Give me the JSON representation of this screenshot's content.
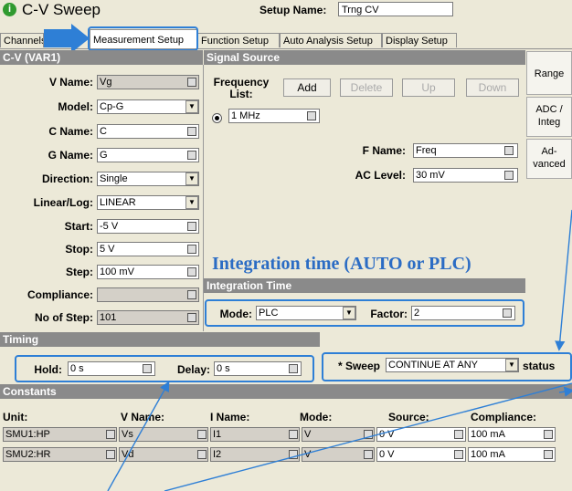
{
  "window": {
    "title": "C-V Sweep",
    "setup_label": "Setup Name:",
    "setup_name": "Trng CV"
  },
  "tabs": [
    {
      "label": "Channels"
    },
    {
      "label": "Measurement Setup"
    },
    {
      "label": "Function Setup"
    },
    {
      "label": "Auto Analysis Setup"
    },
    {
      "label": "Display Setup"
    }
  ],
  "cv": {
    "title": "C-V (VAR1)",
    "vname_label": "V Name:",
    "vname": "Vg",
    "model_label": "Model:",
    "model": "Cp-G",
    "cname_label": "C Name:",
    "cname": "C",
    "gname_label": "G Name:",
    "gname": "G",
    "direction_label": "Direction:",
    "direction": "Single",
    "linlog_label": "Linear/Log:",
    "linlog": "LINEAR",
    "start_label": "Start:",
    "start": "-5 V",
    "stop_label": "Stop:",
    "stop": "5 V",
    "step_label": "Step:",
    "step": "100 mV",
    "compliance_label": "Compliance:",
    "compliance": "",
    "nostep_label": "No of Step:",
    "nostep": "101"
  },
  "signal": {
    "title": "Signal Source",
    "freq_label": "Frequency List:",
    "add": "Add",
    "delete": "Delete",
    "up": "Up",
    "down": "Down",
    "freq_value": "1 MHz",
    "fname_label": "F Name:",
    "fname": "Freq",
    "aclevel_label": "AC Level:",
    "aclevel": "30 mV"
  },
  "side_buttons": {
    "range": "Range",
    "adc": "ADC / Integ",
    "advanced": "Ad-vanced"
  },
  "annotation": "Integration time (AUTO or PLC)",
  "integration": {
    "title": "Integration Time",
    "mode_label": "Mode:",
    "mode": "PLC",
    "factor_label": "Factor:",
    "factor": "2"
  },
  "timing": {
    "title": "Timing",
    "hold_label": "Hold:",
    "hold": "0 s",
    "delay_label": "Delay:",
    "delay": "0 s"
  },
  "sweep": {
    "label": "* Sweep",
    "value": "CONTINUE AT ANY",
    "status": "status"
  },
  "constants": {
    "title": "Constants",
    "headers": [
      "Unit:",
      "V Name:",
      "I Name:",
      "Mode:",
      "Source:",
      "Compliance:"
    ],
    "rows": [
      {
        "unit": "SMU1:HP",
        "vname": "Vs",
        "iname": "I1",
        "mode": "V",
        "source": "0 V",
        "compliance": "100 mA"
      },
      {
        "unit": "SMU2:HR",
        "vname": "Vd",
        "iname": "I2",
        "mode": "V",
        "source": "0 V",
        "compliance": "100 mA"
      }
    ]
  },
  "colors": {
    "highlight": "#2e7fd6",
    "section": "#8a8a8a"
  }
}
